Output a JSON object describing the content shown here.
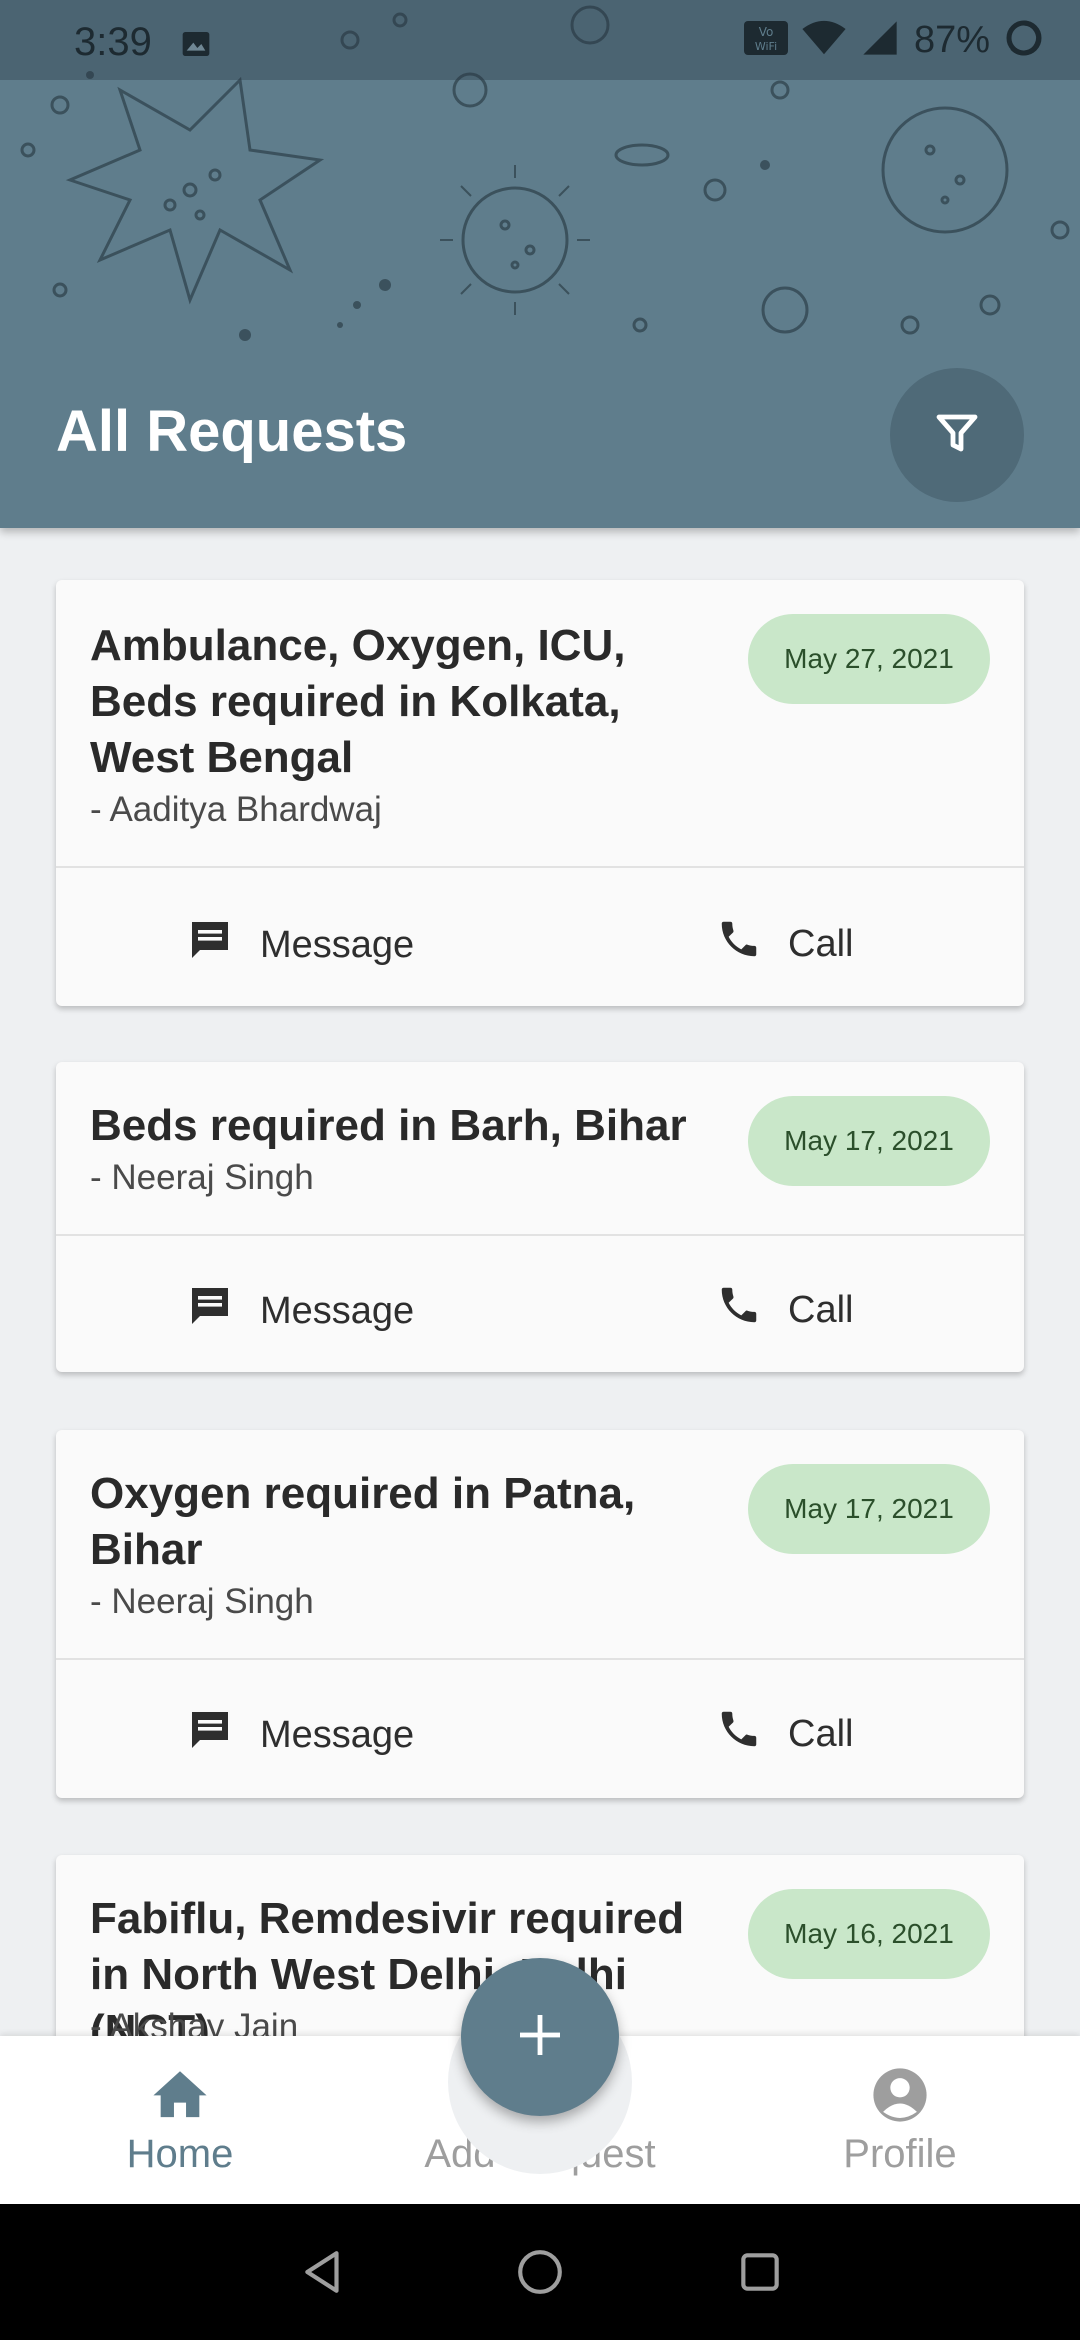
{
  "status_bar": {
    "time": "3:39",
    "battery": "87%",
    "icons": [
      "image-icon",
      "volte-wifi-icon",
      "wifi-icon",
      "signal-icon",
      "battery-icon"
    ]
  },
  "header": {
    "title": "All Requests",
    "filter_icon": "filter-icon",
    "background_color": "#5f7d8c"
  },
  "requests": [
    {
      "title": "Ambulance, Oxygen, ICU, Beds required in Kolkata, West Bengal",
      "author": "- Aaditya Bhardwaj",
      "date": "May 27, 2021",
      "message_label": "Message",
      "call_label": "Call"
    },
    {
      "title": "Beds required in Barh, Bihar",
      "author": "- Neeraj Singh",
      "date": "May 17, 2021",
      "message_label": "Message",
      "call_label": "Call"
    },
    {
      "title": "Oxygen required in Patna, Bihar",
      "author": "- Neeraj Singh",
      "date": "May 17, 2021",
      "message_label": "Message",
      "call_label": "Call"
    },
    {
      "title": "Fabiflu, Remdesivir required in North West Delhi, Delhi (NCT)",
      "author": "- Akshay Jain",
      "date": "May 16, 2021"
    }
  ],
  "bottom_nav": {
    "items": [
      {
        "label": "Home",
        "icon": "home-icon",
        "active": true
      },
      {
        "label": "Add Request",
        "icon": "plus-icon",
        "active": false
      },
      {
        "label": "Profile",
        "icon": "profile-icon",
        "active": false
      }
    ]
  },
  "colors": {
    "accent": "#5f7d8c",
    "date_pill": "#c9e7c9",
    "date_text": "#2b4f2b"
  }
}
